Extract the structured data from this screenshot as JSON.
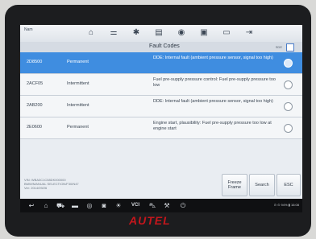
{
  "app": {
    "label": "Nam"
  },
  "toolbar": {
    "icons": [
      "home-icon",
      "vehicle-icon",
      "settings-icon",
      "print-icon",
      "help-icon",
      "screenshot-icon",
      "save-icon",
      "exit-icon"
    ]
  },
  "table": {
    "header": "Fault Codes",
    "header_extra": "SDE"
  },
  "faults": [
    {
      "code": "2D8500",
      "status": "Permanent",
      "description": "DDE: Internal fault (ambient pressure sensor, signal too high)"
    },
    {
      "code": "2ACF05",
      "status": "Intermittent",
      "description": "Fuel pre-supply pressure control: Fuel pre-supply pressure too low"
    },
    {
      "code": "2AB200",
      "status": "Intermittent",
      "description": "DDE: Internal fault (ambient pressure sensor, signal too high)"
    },
    {
      "code": "2E0600",
      "status": "Permanent",
      "description": "Engine start, plausibility: Fuel pre-supply pressure too low at engine start"
    }
  ],
  "vehicle_info": {
    "line1": "VIN: WBA3C1C58DK000000",
    "line2": "BMW/MANUAL SELECTION/F30/N47",
    "line3": "Ver: 2014/09/26"
  },
  "buttons": {
    "freeze_frame": "Freeze Frame",
    "search": "Search",
    "esc": "ESC"
  },
  "system_bar": {
    "icons": [
      "back-icon",
      "home-icon",
      "car-icon",
      "messages-icon",
      "chrome-icon",
      "camera-icon",
      "brightness-icon",
      "vci-icon",
      "vehicle-icon",
      "tool-icon",
      "power-icon"
    ],
    "vci_label": "VCI",
    "status_right": "⊙ ⊙ 94% ▮ 16:08"
  },
  "brand": "AUTEL"
}
